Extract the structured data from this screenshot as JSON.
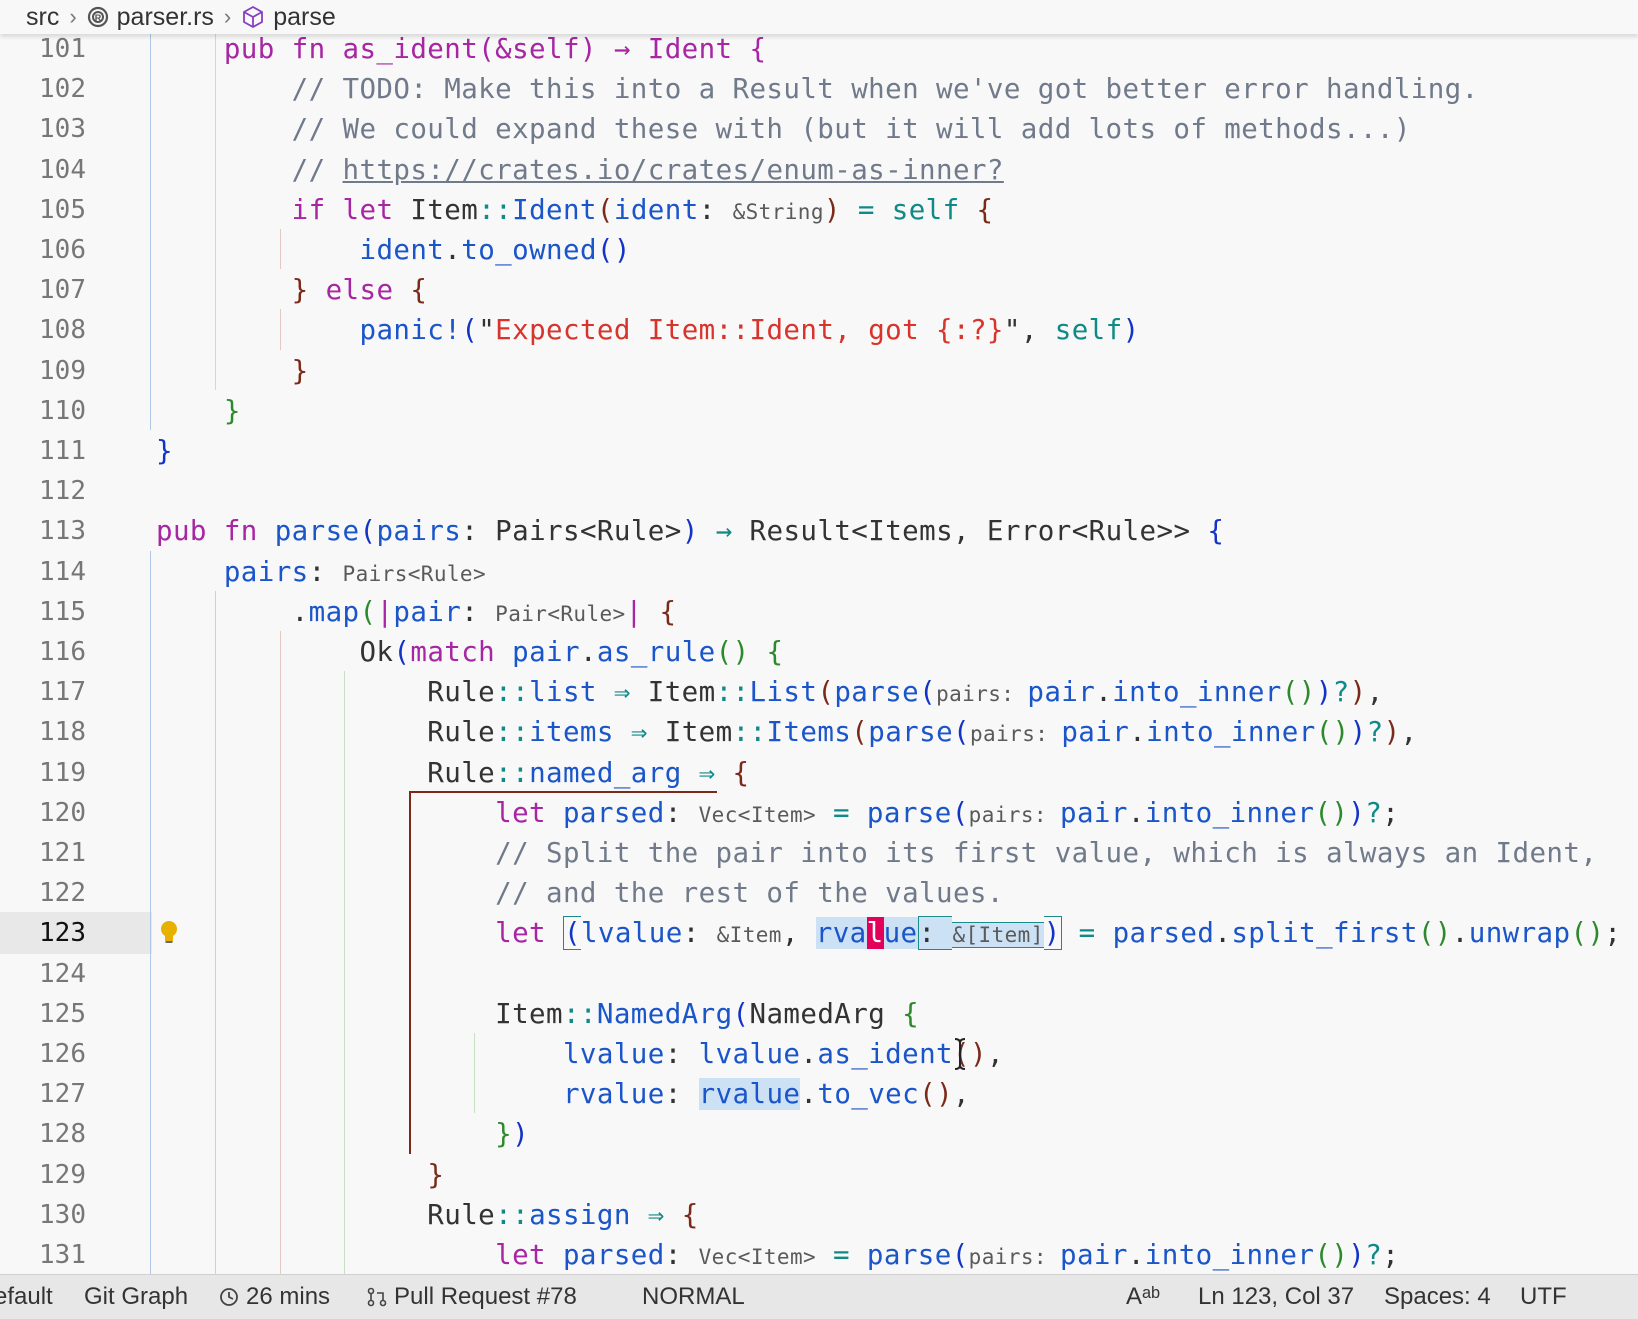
{
  "breadcrumb": {
    "items": [
      {
        "label": "src",
        "icon": ""
      },
      {
        "label": "parser.rs",
        "icon": "rust-file-icon"
      },
      {
        "label": "parse",
        "icon": "cube-icon"
      }
    ]
  },
  "colors": {
    "keyword": "#a626a4",
    "function": "#1a55c9",
    "variable": "#1a55c9",
    "type": "#333333",
    "comment": "#707a8a",
    "string": "#d7342b",
    "macro": "#1a55c9",
    "self": "#0f8a87",
    "operator": "#0f8a87",
    "bracket_1": "#1233c6",
    "bracket_2": "#2c8a2c",
    "bracket_3": "#7b2a1a",
    "hint": "#5a5a5a",
    "selection": "#cde1f5",
    "cursor": "#e2005a",
    "lightbulb": "#e8b100"
  },
  "editor": {
    "current_line": "123",
    "lines": [
      {
        "number": "101",
        "tokens": [
          {
            "t": "    pub fn as_ident(&self) → Ident {",
            "c": "kw"
          }
        ]
      },
      {
        "number": "102",
        "tokens": [
          {
            "t": "        // TODO: Make this into a Result when we've got better error handling.",
            "c": "com"
          }
        ]
      },
      {
        "number": "103",
        "tokens": [
          {
            "t": "        // We could expand these with (but it will add lots of methods...)",
            "c": "com"
          }
        ]
      },
      {
        "number": "104",
        "tokens": [
          {
            "t": "        // ",
            "c": "com"
          },
          {
            "t": "https://crates.io/crates/enum-as-inner?",
            "c": "com url"
          }
        ]
      },
      {
        "number": "105",
        "tokens": [
          {
            "t": "        ",
            "c": ""
          },
          {
            "t": "if let ",
            "c": "kw"
          },
          {
            "t": "Item",
            "c": "ty"
          },
          {
            "t": "::",
            "c": "op"
          },
          {
            "t": "Ident",
            "c": "fn"
          },
          {
            "t": "(",
            "c": "b3"
          },
          {
            "t": "ident",
            "c": "var"
          },
          {
            "t": ": ",
            "c": "ty"
          },
          {
            "t": "&String",
            "c": "hint"
          },
          {
            "t": ")",
            "c": "b3"
          },
          {
            "t": " = ",
            "c": "op"
          },
          {
            "t": "self",
            "c": "self"
          },
          {
            "t": " {",
            "c": "b3"
          }
        ]
      },
      {
        "number": "106",
        "tokens": [
          {
            "t": "            ",
            "c": ""
          },
          {
            "t": "ident",
            "c": "var"
          },
          {
            "t": ".",
            "c": "ty"
          },
          {
            "t": "to_owned",
            "c": "fn"
          },
          {
            "t": "()",
            "c": "b1"
          }
        ]
      },
      {
        "number": "107",
        "tokens": [
          {
            "t": "        ",
            "c": ""
          },
          {
            "t": "}",
            "c": "b3"
          },
          {
            "t": " else ",
            "c": "kw"
          },
          {
            "t": "{",
            "c": "b3"
          }
        ]
      },
      {
        "number": "108",
        "tokens": [
          {
            "t": "            ",
            "c": ""
          },
          {
            "t": "panic!",
            "c": "fn"
          },
          {
            "t": "(",
            "c": "b1"
          },
          {
            "t": "\"",
            "c": "ty"
          },
          {
            "t": "Expected Item::Ident, got {:?}",
            "c": "str"
          },
          {
            "t": "\"",
            "c": "ty"
          },
          {
            "t": ", ",
            "c": "ty"
          },
          {
            "t": "self",
            "c": "self"
          },
          {
            "t": ")",
            "c": "b1"
          }
        ]
      },
      {
        "number": "109",
        "tokens": [
          {
            "t": "        ",
            "c": ""
          },
          {
            "t": "}",
            "c": "b3"
          }
        ]
      },
      {
        "number": "110",
        "tokens": [
          {
            "t": "    ",
            "c": ""
          },
          {
            "t": "}",
            "c": "b2"
          }
        ]
      },
      {
        "number": "111",
        "tokens": [
          {
            "t": "}",
            "c": "b1"
          }
        ]
      },
      {
        "number": "112",
        "tokens": []
      },
      {
        "number": "113",
        "tokens": [
          {
            "t": "pub fn ",
            "c": "kw"
          },
          {
            "t": "parse",
            "c": "fn"
          },
          {
            "t": "(",
            "c": "b1"
          },
          {
            "t": "pairs",
            "c": "var"
          },
          {
            "t": ": Pairs<Rule>",
            "c": "ty"
          },
          {
            "t": ")",
            "c": "b1"
          },
          {
            "t": " → ",
            "c": "op"
          },
          {
            "t": "Result<Items, Error<Rule>> ",
            "c": "ty"
          },
          {
            "t": "{",
            "c": "b1"
          }
        ]
      },
      {
        "number": "114",
        "tokens": [
          {
            "t": "    ",
            "c": ""
          },
          {
            "t": "pairs",
            "c": "var"
          },
          {
            "t": ": ",
            "c": "ty"
          },
          {
            "t": "Pairs<Rule>",
            "c": "hint"
          }
        ]
      },
      {
        "number": "115",
        "tokens": [
          {
            "t": "        .",
            "c": "ty"
          },
          {
            "t": "map",
            "c": "fn"
          },
          {
            "t": "(",
            "c": "b2"
          },
          {
            "t": "|",
            "c": "kw"
          },
          {
            "t": "pair",
            "c": "var"
          },
          {
            "t": ": ",
            "c": "ty"
          },
          {
            "t": "Pair<Rule>",
            "c": "hint"
          },
          {
            "t": "|",
            "c": "kw"
          },
          {
            "t": " {",
            "c": "b3"
          }
        ]
      },
      {
        "number": "116",
        "tokens": [
          {
            "t": "            Ok",
            "c": "ty"
          },
          {
            "t": "(",
            "c": "b1"
          },
          {
            "t": "match ",
            "c": "kw"
          },
          {
            "t": "pair",
            "c": "var"
          },
          {
            "t": ".",
            "c": "ty"
          },
          {
            "t": "as_rule",
            "c": "fn"
          },
          {
            "t": "()",
            "c": "b2"
          },
          {
            "t": " {",
            "c": "b2"
          }
        ]
      },
      {
        "number": "117",
        "tokens": [
          {
            "t": "                Rule",
            "c": "ty"
          },
          {
            "t": "::",
            "c": "op"
          },
          {
            "t": "list",
            "c": "fn"
          },
          {
            "t": " ⇒ ",
            "c": "op"
          },
          {
            "t": "Item",
            "c": "ty"
          },
          {
            "t": "::",
            "c": "op"
          },
          {
            "t": "List",
            "c": "fn"
          },
          {
            "t": "(",
            "c": "b3"
          },
          {
            "t": "parse",
            "c": "fn"
          },
          {
            "t": "(",
            "c": "b1"
          },
          {
            "t": "pairs: ",
            "c": "hint"
          },
          {
            "t": "pair",
            "c": "var"
          },
          {
            "t": ".",
            "c": "ty"
          },
          {
            "t": "into_inner",
            "c": "fn"
          },
          {
            "t": "()",
            "c": "b2"
          },
          {
            "t": ")",
            "c": "b1"
          },
          {
            "t": "?",
            "c": "op"
          },
          {
            "t": ")",
            "c": "b3"
          },
          {
            "t": ",",
            "c": "ty"
          }
        ]
      },
      {
        "number": "118",
        "tokens": [
          {
            "t": "                Rule",
            "c": "ty"
          },
          {
            "t": "::",
            "c": "op"
          },
          {
            "t": "items",
            "c": "fn"
          },
          {
            "t": " ⇒ ",
            "c": "op"
          },
          {
            "t": "Item",
            "c": "ty"
          },
          {
            "t": "::",
            "c": "op"
          },
          {
            "t": "Items",
            "c": "fn"
          },
          {
            "t": "(",
            "c": "b3"
          },
          {
            "t": "parse",
            "c": "fn"
          },
          {
            "t": "(",
            "c": "b1"
          },
          {
            "t": "pairs: ",
            "c": "hint"
          },
          {
            "t": "pair",
            "c": "var"
          },
          {
            "t": ".",
            "c": "ty"
          },
          {
            "t": "into_inner",
            "c": "fn"
          },
          {
            "t": "()",
            "c": "b2"
          },
          {
            "t": ")",
            "c": "b1"
          },
          {
            "t": "?",
            "c": "op"
          },
          {
            "t": ")",
            "c": "b3"
          },
          {
            "t": ",",
            "c": "ty"
          }
        ]
      },
      {
        "number": "119",
        "tokens": [
          {
            "t": "                Rule",
            "c": "ty"
          },
          {
            "t": "::",
            "c": "op"
          },
          {
            "t": "named_arg",
            "c": "fn"
          },
          {
            "t": " ⇒ ",
            "c": "op"
          },
          {
            "t": "{",
            "c": "b3"
          }
        ]
      },
      {
        "number": "120",
        "tokens": [
          {
            "t": "                    ",
            "c": ""
          },
          {
            "t": "let ",
            "c": "kw"
          },
          {
            "t": "parsed",
            "c": "var"
          },
          {
            "t": ": ",
            "c": "ty"
          },
          {
            "t": "Vec<Item>",
            "c": "hint"
          },
          {
            "t": " = ",
            "c": "op"
          },
          {
            "t": "parse",
            "c": "fn"
          },
          {
            "t": "(",
            "c": "b1"
          },
          {
            "t": "pairs: ",
            "c": "hint"
          },
          {
            "t": "pair",
            "c": "var"
          },
          {
            "t": ".",
            "c": "ty"
          },
          {
            "t": "into_inner",
            "c": "fn"
          },
          {
            "t": "()",
            "c": "b2"
          },
          {
            "t": ")",
            "c": "b1"
          },
          {
            "t": "?",
            "c": "op"
          },
          {
            "t": ";",
            "c": "ty"
          }
        ]
      },
      {
        "number": "121",
        "tokens": [
          {
            "t": "                    // Split the pair into its first value, which is always an Ident,",
            "c": "com"
          }
        ]
      },
      {
        "number": "122",
        "tokens": [
          {
            "t": "                    // and the rest of the values.",
            "c": "com"
          }
        ]
      },
      {
        "number": "123",
        "tokens": [
          {
            "t": "                    ",
            "c": ""
          },
          {
            "t": "let ",
            "c": "kw"
          },
          {
            "t": "(",
            "c": "b1 box-l"
          },
          {
            "t": "lvalue",
            "c": "var"
          },
          {
            "t": ": ",
            "c": "ty"
          },
          {
            "t": "&Item",
            "c": "hint"
          },
          {
            "t": ", ",
            "c": "ty"
          },
          {
            "t": "rva",
            "c": "var sel"
          },
          {
            "t": "l",
            "c": "var cur"
          },
          {
            "t": "ue",
            "c": "var sel"
          },
          {
            "t": ": ",
            "c": "ty sel box-l"
          },
          {
            "t": "&[Item]",
            "c": "hint box-m"
          },
          {
            "t": ")",
            "c": "b1 box-r"
          },
          {
            "t": " = ",
            "c": "op"
          },
          {
            "t": "parsed",
            "c": "var"
          },
          {
            "t": ".",
            "c": "ty"
          },
          {
            "t": "split_first",
            "c": "fn"
          },
          {
            "t": "()",
            "c": "b2"
          },
          {
            "t": ".",
            "c": "ty"
          },
          {
            "t": "unwrap",
            "c": "fn"
          },
          {
            "t": "()",
            "c": "b2"
          },
          {
            "t": ";",
            "c": "ty"
          }
        ]
      },
      {
        "number": "124",
        "tokens": []
      },
      {
        "number": "125",
        "tokens": [
          {
            "t": "                    Item",
            "c": "ty"
          },
          {
            "t": "::",
            "c": "op"
          },
          {
            "t": "NamedArg",
            "c": "fn"
          },
          {
            "t": "(",
            "c": "b1"
          },
          {
            "t": "NamedArg ",
            "c": "ty"
          },
          {
            "t": "{",
            "c": "b2"
          }
        ]
      },
      {
        "number": "126",
        "tokens": [
          {
            "t": "                        ",
            "c": ""
          },
          {
            "t": "lvalue",
            "c": "var"
          },
          {
            "t": ": ",
            "c": "ty"
          },
          {
            "t": "lvalue",
            "c": "var"
          },
          {
            "t": ".",
            "c": "ty"
          },
          {
            "t": "as_ident",
            "c": "fn"
          },
          {
            "t": "()",
            "c": "b3"
          },
          {
            "t": ",",
            "c": "ty"
          }
        ]
      },
      {
        "number": "127",
        "tokens": [
          {
            "t": "                        ",
            "c": ""
          },
          {
            "t": "rvalue",
            "c": "var"
          },
          {
            "t": ": ",
            "c": "ty"
          },
          {
            "t": "rvalue",
            "c": "var sel"
          },
          {
            "t": ".",
            "c": "ty"
          },
          {
            "t": "to_vec",
            "c": "fn"
          },
          {
            "t": "()",
            "c": "b3"
          },
          {
            "t": ",",
            "c": "ty"
          }
        ]
      },
      {
        "number": "128",
        "tokens": [
          {
            "t": "                    ",
            "c": ""
          },
          {
            "t": "}",
            "c": "b2"
          },
          {
            "t": ")",
            "c": "b1"
          }
        ]
      },
      {
        "number": "129",
        "tokens": [
          {
            "t": "                ",
            "c": ""
          },
          {
            "t": "}",
            "c": "b3"
          }
        ]
      },
      {
        "number": "130",
        "tokens": [
          {
            "t": "                Rule",
            "c": "ty"
          },
          {
            "t": "::",
            "c": "op"
          },
          {
            "t": "assign",
            "c": "fn"
          },
          {
            "t": " ⇒ ",
            "c": "op"
          },
          {
            "t": "{",
            "c": "b3"
          }
        ]
      },
      {
        "number": "131",
        "tokens": [
          {
            "t": "                    ",
            "c": ""
          },
          {
            "t": "let ",
            "c": "kw"
          },
          {
            "t": "parsed",
            "c": "var"
          },
          {
            "t": ": ",
            "c": "ty"
          },
          {
            "t": "Vec<Item>",
            "c": "hint"
          },
          {
            "t": " = ",
            "c": "op"
          },
          {
            "t": "parse",
            "c": "fn"
          },
          {
            "t": "(",
            "c": "b1"
          },
          {
            "t": "pairs: ",
            "c": "hint"
          },
          {
            "t": "pair",
            "c": "var"
          },
          {
            "t": ".",
            "c": "ty"
          },
          {
            "t": "into_inner",
            "c": "fn"
          },
          {
            "t": "()",
            "c": "b2"
          },
          {
            "t": ")",
            "c": "b1"
          },
          {
            "t": "?",
            "c": "op"
          },
          {
            "t": ";",
            "c": "ty"
          }
        ]
      }
    ]
  },
  "statusbar": {
    "items": [
      {
        "label": "efault",
        "icon": ""
      },
      {
        "label": "Git Graph",
        "icon": ""
      },
      {
        "label": "26 mins",
        "icon": "history-icon"
      },
      {
        "label": "Pull Request #78",
        "icon": "pull-request-icon"
      },
      {
        "label": "NORMAL",
        "icon": ""
      },
      {
        "label": "Aᵃᵇ",
        "icon": ""
      },
      {
        "label": "Ln 123, Col 37",
        "icon": ""
      },
      {
        "label": "Spaces: 4",
        "icon": ""
      },
      {
        "label": "UTF",
        "icon": ""
      }
    ]
  }
}
